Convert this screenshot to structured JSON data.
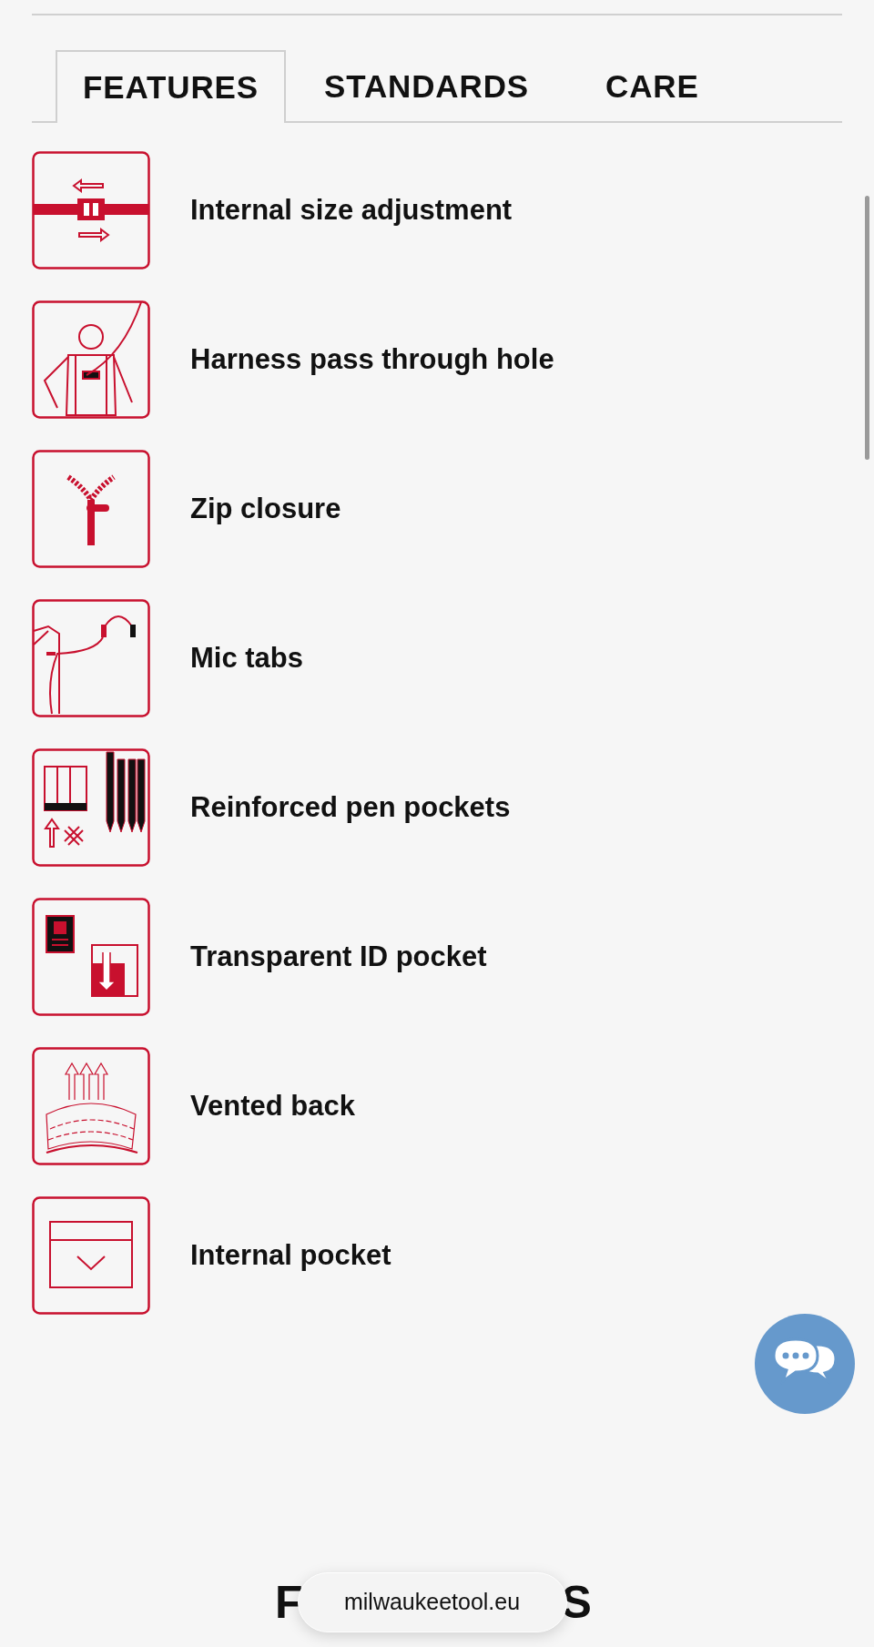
{
  "tabs": [
    {
      "label": "FEATURES",
      "selected": true
    },
    {
      "label": "STANDARDS",
      "selected": false
    },
    {
      "label": "CARE",
      "selected": false
    }
  ],
  "features": [
    {
      "kind": "size",
      "label": "Internal size adjustment"
    },
    {
      "kind": "harness",
      "label": "Harness pass through hole"
    },
    {
      "kind": "zip",
      "label": "Zip closure"
    },
    {
      "kind": "mic",
      "label": "Mic tabs"
    },
    {
      "kind": "pens",
      "label": "Reinforced pen pockets"
    },
    {
      "kind": "id",
      "label": "Transparent ID pocket"
    },
    {
      "kind": "vent",
      "label": "Vented back"
    },
    {
      "kind": "pocket",
      "label": "Internal pocket"
    }
  ],
  "bottom_heading": {
    "left": "F",
    "right": "S"
  },
  "url_bar": {
    "text": "milwaukeetool.eu"
  }
}
